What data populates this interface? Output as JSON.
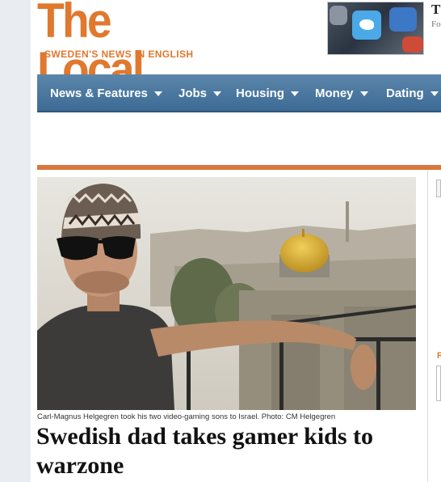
{
  "site": {
    "logo_title": "The Local",
    "logo_tagline": "SWEDEN'S NEWS IN ENGLISH"
  },
  "promo": {
    "title_fragment": "T",
    "sub_fragment": "Fo",
    "icons": [
      "twitter-app-icon",
      "app-icon",
      "app-icon",
      "app-icon"
    ]
  },
  "nav": {
    "items": [
      {
        "label": "News & Features"
      },
      {
        "label": "Jobs"
      },
      {
        "label": "Housing"
      },
      {
        "label": "Money"
      },
      {
        "label": "Dating"
      }
    ]
  },
  "article": {
    "photo_caption": "Carl-Magnus Helgegren took his two video-gaming sons to Israel. Photo: CM Helgegren",
    "headline": "Swedish dad takes gamer kids to warzone"
  },
  "sidebar": {
    "fragment_letter": "R"
  },
  "colors": {
    "brand_orange": "#e0782e",
    "nav_blue": "#4a77a0",
    "rule_orange": "#d9773b"
  }
}
